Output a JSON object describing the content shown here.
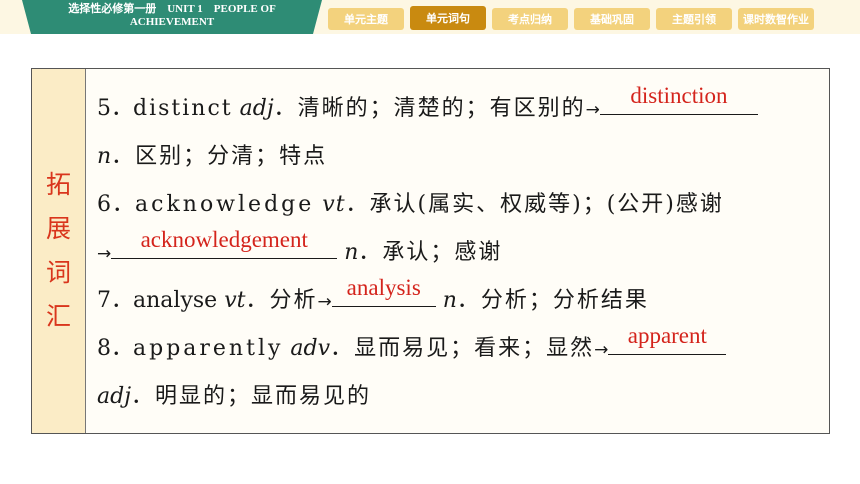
{
  "header": {
    "book_title_line1": "选择性必修第一册　UNIT 1　PEOPLE OF",
    "book_title_line2": "ACHIEVEMENT",
    "tabs": [
      {
        "label": "单元主题",
        "active": false
      },
      {
        "label": "单元词句",
        "active": true
      },
      {
        "label": "考点归纳",
        "active": false
      },
      {
        "label": "基础巩固",
        "active": false
      },
      {
        "label": "主题引领",
        "active": false
      },
      {
        "label": "课时数智作业",
        "active": false
      }
    ]
  },
  "colors": {
    "banner_green": "#2e8c75",
    "tab_inactive": "#f3d27d",
    "tab_active": "#c98a10",
    "answer_red": "#d4241c",
    "side_label_red": "#d9351c",
    "side_bg": "#fbecc6"
  },
  "section": {
    "side_label": [
      "拓",
      "展",
      "词",
      "汇"
    ],
    "items": [
      {
        "num": "5．",
        "word": "distinct",
        "pos": "adj",
        "meaning": "．清晰的；清楚的；有区别的",
        "arrow": "→",
        "answer": "distinction",
        "answer_pos": "n",
        "answer_meaning": "．区别；分清；特点"
      },
      {
        "num": "6．",
        "word": "acknowledge",
        "pos": "vt",
        "meaning": "．承认(属实、权威等)；(公开)感谢",
        "arrow": "→",
        "answer": "acknowledgement",
        "answer_pos": "n",
        "answer_meaning": "．承认；感谢"
      },
      {
        "num": "7．",
        "word": "analyse",
        "pos": "vt",
        "meaning": "．分析",
        "arrow": "→",
        "answer": "analysis",
        "answer_pos": "n",
        "answer_meaning": "．分析；分析结果"
      },
      {
        "num": "8．",
        "word": "apparently",
        "pos": "adv",
        "meaning": "．显而易见；看来；显然",
        "arrow": "→",
        "answer": "apparent",
        "answer_pos": "adj",
        "answer_meaning": "．明显的；显而易见的"
      }
    ]
  }
}
